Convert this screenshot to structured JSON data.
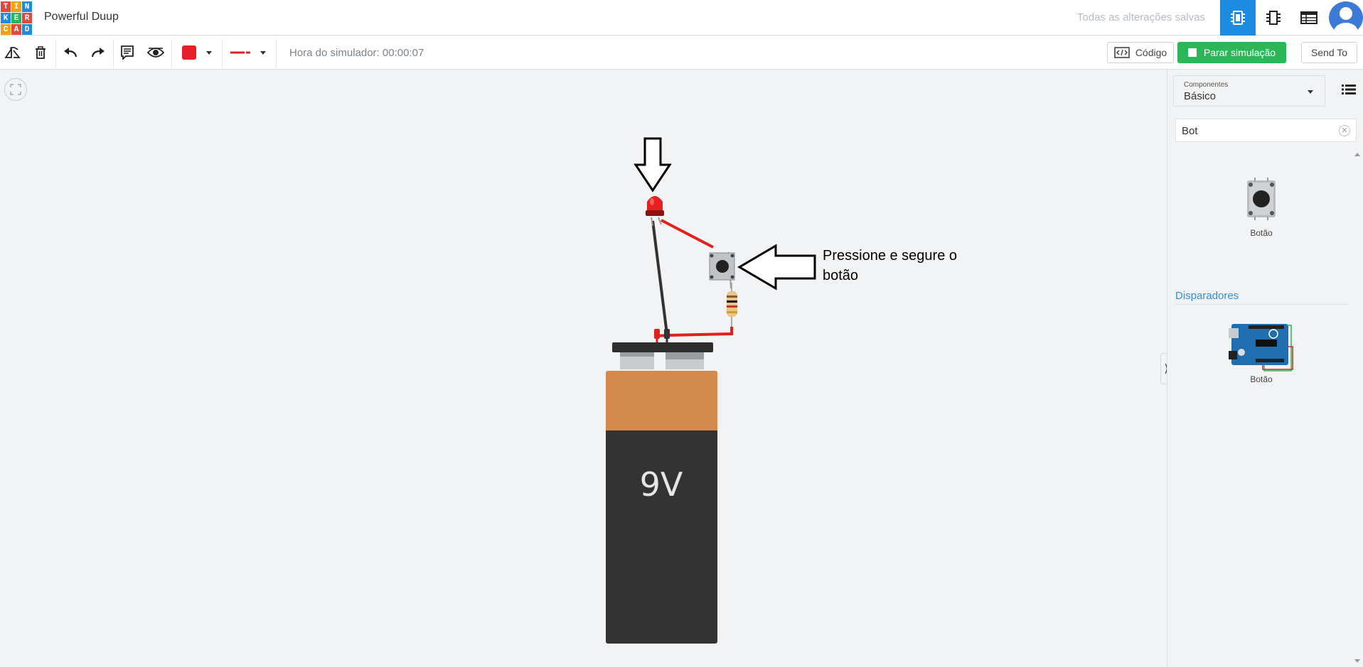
{
  "header": {
    "logo_letters": [
      "T",
      "I",
      "N",
      "K",
      "E",
      "R",
      "C",
      "A",
      "D"
    ],
    "logo_colors": [
      "#e04a3b",
      "#f0a017",
      "#1d8ce0",
      "#1d8ce0",
      "#2bb657",
      "#e04a3b",
      "#f0a017",
      "#e04a3b",
      "#1d8ce0"
    ],
    "project_title": "Powerful Duup",
    "save_status": "Todas as alterações salvas",
    "views": [
      {
        "icon": "circuit-view-icon",
        "active": true
      },
      {
        "icon": "schematic-view-icon",
        "active": false
      },
      {
        "icon": "component-list-icon",
        "active": false
      }
    ],
    "avatar_icon": "user-avatar-icon"
  },
  "toolbar": {
    "icons": [
      "rotate-icon",
      "trash-icon",
      "undo-icon",
      "redo-icon",
      "notes-icon",
      "visibility-icon"
    ],
    "wire_color": "#e8202a",
    "simulator_time_label": "Hora do simulador: 00:00:07",
    "code_label": "Código",
    "stop_label": "Parar simulação",
    "send_label": "Send To"
  },
  "canvas": {
    "battery_label": "9V",
    "annotation": "Pressione e segure o botão"
  },
  "panel": {
    "select_label": "Componentes",
    "select_value": "Básico",
    "search_value": "Bot",
    "items": [
      {
        "label": "Botão"
      }
    ],
    "section_title": "Disparadores",
    "trigger_items": [
      {
        "label": "Botão"
      }
    ]
  },
  "colors": {
    "accent_blue": "#1d8ce0",
    "sim_green": "#2bb657",
    "wire_red": "#e0211d",
    "battery_orange": "#d38a4c",
    "battery_black": "#333333"
  }
}
